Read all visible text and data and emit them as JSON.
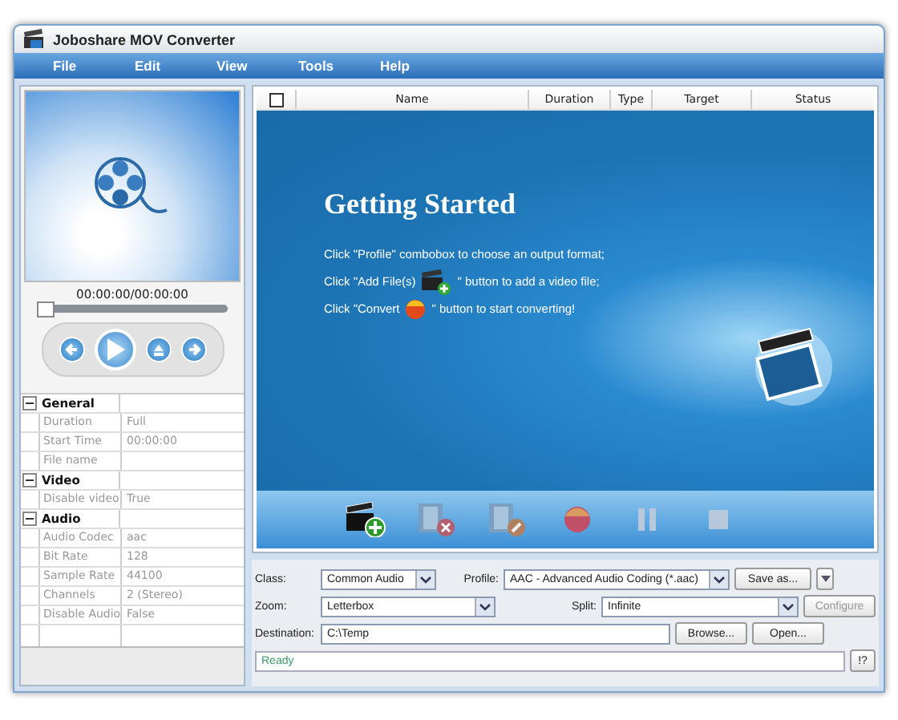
{
  "window": {
    "title": "Joboshare MOV Converter"
  },
  "menu": [
    {
      "label": "File"
    },
    {
      "label": "Edit"
    },
    {
      "label": "View"
    },
    {
      "label": "Tools"
    },
    {
      "label": "Help"
    }
  ],
  "player": {
    "timecode": "00:00:00/00:00:00",
    "level": 0
  },
  "properties": [
    {
      "label": "General",
      "expanded": true,
      "children": [
        {
          "name": "Duration",
          "value": "Full"
        },
        {
          "name": "Start Time",
          "value": "00:00:00"
        },
        {
          "name": "File name"
        }
      ]
    },
    {
      "label": "Video",
      "expanded": true,
      "children": [
        {
          "name": "Disable video",
          "value": "True"
        }
      ]
    },
    {
      "label": "Audio",
      "expanded": true,
      "children": [
        {
          "name": "Audio Codec",
          "value": "aac"
        },
        {
          "name": "Bit Rate",
          "value": "128"
        },
        {
          "name": "Sample Rate",
          "value": "44100"
        },
        {
          "name": "Channels",
          "value": "2 (Stereo)"
        },
        {
          "name": "Disable Audio",
          "value": "False"
        }
      ]
    }
  ],
  "file_list": {
    "select_all_checked": false,
    "columns": [
      "Name",
      "Duration",
      "Type",
      "Target",
      "Status"
    ]
  },
  "getting_started": {
    "title": "Getting Started",
    "lines": [
      {
        "before": "Click \"Profile\" combobox to choose an output format;"
      },
      {
        "before": "Click \"Add File(s)",
        "after": "\" button to add a video file;"
      },
      {
        "before": "Click \"Convert",
        "after": "\" button to start converting!"
      }
    ]
  },
  "form": {
    "class_label": "Class:",
    "class_value": "Common Audio",
    "profile_label": "Profile:",
    "profile_value": "AAC - Advanced Audio Coding  (*.aac)",
    "save_as": "Save as...",
    "zoom_label": "Zoom:",
    "zoom_value": "Letterbox",
    "split_label": "Split:",
    "split_value": "Infinite",
    "configure": "Configure",
    "configure_disabled": true,
    "destination_label": "Destination:",
    "destination_value": "C:\\Temp",
    "browse": "Browse...",
    "open": "Open..."
  },
  "status_bar": {
    "text": "Ready",
    "help": "!?"
  }
}
